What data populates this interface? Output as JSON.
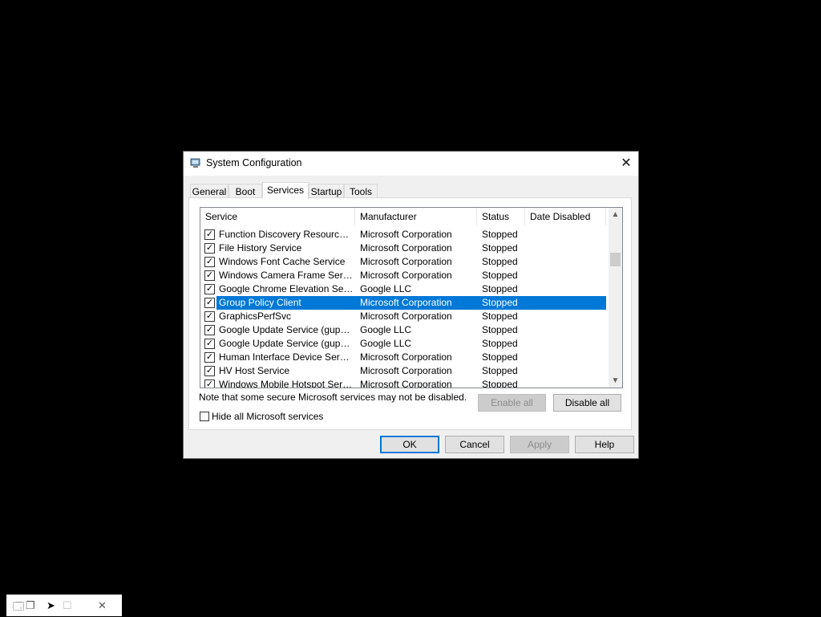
{
  "window": {
    "title": "System Configuration",
    "close_icon": "close-icon",
    "app_icon": "system-configuration-icon"
  },
  "tabs": [
    {
      "label": "General",
      "active": false
    },
    {
      "label": "Boot",
      "active": false
    },
    {
      "label": "Services",
      "active": true
    },
    {
      "label": "Startup",
      "active": false
    },
    {
      "label": "Tools",
      "active": false
    }
  ],
  "services_list": {
    "columns": [
      "Service",
      "Manufacturer",
      "Status",
      "Date Disabled"
    ],
    "rows": [
      {
        "service": "Function Discovery Resource Pu...",
        "manufacturer": "Microsoft Corporation",
        "status": "Stopped",
        "checked": true,
        "selected": false
      },
      {
        "service": "File History Service",
        "manufacturer": "Microsoft Corporation",
        "status": "Stopped",
        "checked": true,
        "selected": false
      },
      {
        "service": "Windows Font Cache Service",
        "manufacturer": "Microsoft Corporation",
        "status": "Stopped",
        "checked": true,
        "selected": false
      },
      {
        "service": "Windows Camera Frame Server",
        "manufacturer": "Microsoft Corporation",
        "status": "Stopped",
        "checked": true,
        "selected": false
      },
      {
        "service": "Google Chrome Elevation Servic...",
        "manufacturer": "Google LLC",
        "status": "Stopped",
        "checked": true,
        "selected": false
      },
      {
        "service": "Group Policy Client",
        "manufacturer": "Microsoft Corporation",
        "status": "Stopped",
        "checked": true,
        "selected": true
      },
      {
        "service": "GraphicsPerfSvc",
        "manufacturer": "Microsoft Corporation",
        "status": "Stopped",
        "checked": true,
        "selected": false
      },
      {
        "service": "Google Update Service (gupdate)",
        "manufacturer": "Google LLC",
        "status": "Stopped",
        "checked": true,
        "selected": false
      },
      {
        "service": "Google Update Service (gupdatem)",
        "manufacturer": "Google LLC",
        "status": "Stopped",
        "checked": true,
        "selected": false
      },
      {
        "service": "Human Interface Device Service",
        "manufacturer": "Microsoft Corporation",
        "status": "Stopped",
        "checked": true,
        "selected": false
      },
      {
        "service": "HV Host Service",
        "manufacturer": "Microsoft Corporation",
        "status": "Stopped",
        "checked": true,
        "selected": false
      },
      {
        "service": "Windows Mobile Hotspot Service",
        "manufacturer": "Microsoft Corporation",
        "status": "Stopped",
        "checked": true,
        "selected": false
      }
    ]
  },
  "note": "Note that some secure Microsoft services may not be disabled.",
  "buttons": {
    "enable_all": "Enable all",
    "disable_all": "Disable all",
    "ok": "OK",
    "cancel": "Cancel",
    "apply": "Apply",
    "help": "Help"
  },
  "hide_microsoft": {
    "label": "Hide all Microsoft services",
    "checked": false
  },
  "colors": {
    "selection": "#0078d7",
    "dialog_bg": "#f0f0f0",
    "desktop": "#000000"
  }
}
